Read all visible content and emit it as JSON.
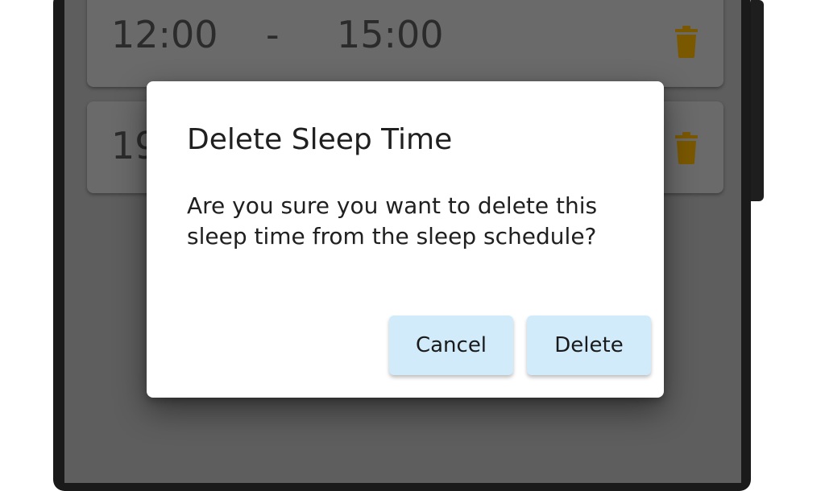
{
  "schedule": {
    "items": [
      {
        "start": "12:00",
        "separator": "-",
        "end": "15:00"
      },
      {
        "start": "19"
      }
    ],
    "trash_icon": "trash-icon",
    "trash_color": "#7a5800"
  },
  "dialog": {
    "title": "Delete Sleep Time",
    "message": "Are you sure you want to delete this sleep time from the sleep schedule?",
    "cancel_label": "Cancel",
    "delete_label": "Delete",
    "button_color": "#d2ebfb"
  }
}
